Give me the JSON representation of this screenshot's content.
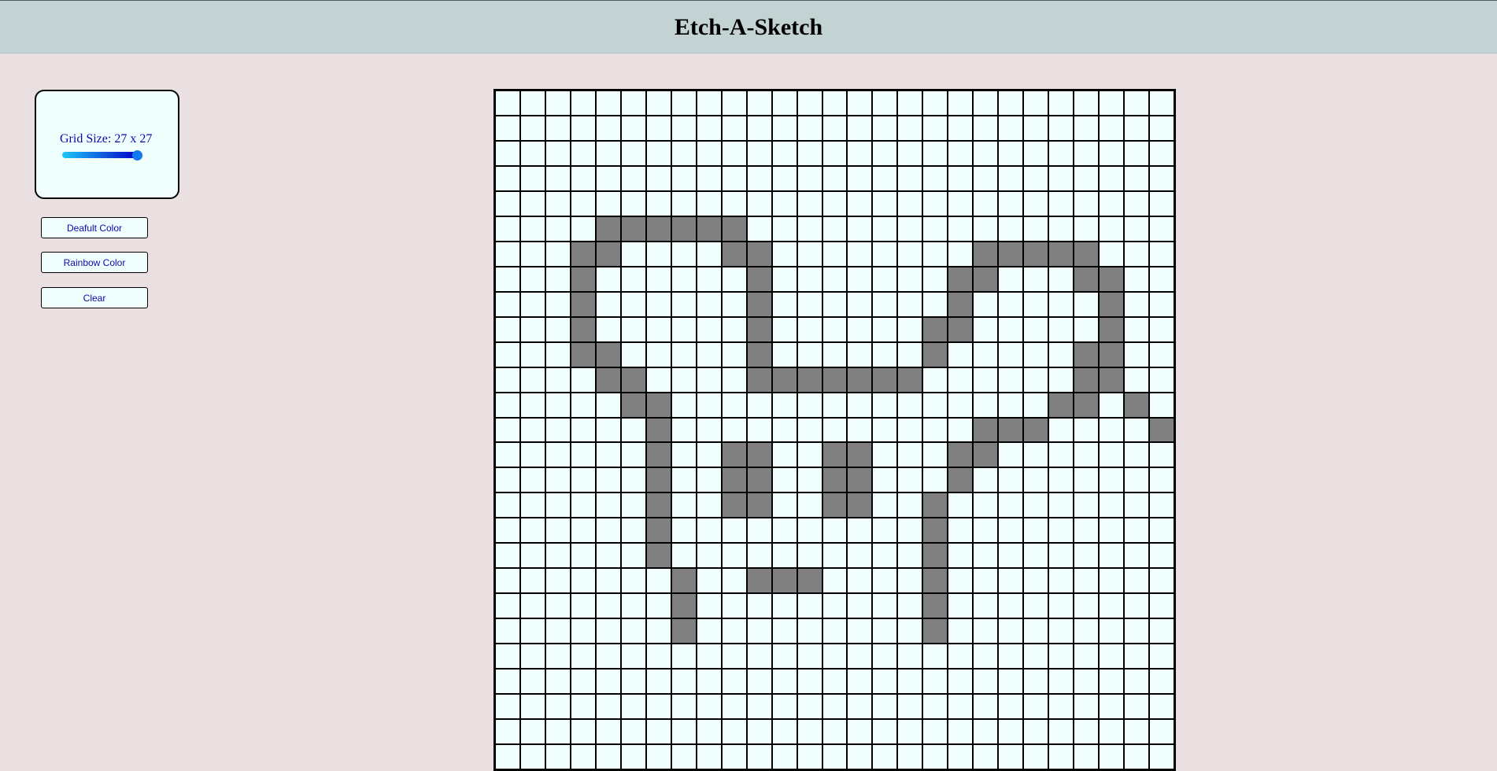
{
  "header": {
    "title": "Etch-A-Sketch"
  },
  "controls": {
    "grid_size_label": "Grid Size: 27 x 27",
    "slider": {
      "min": 1,
      "max": 27,
      "value": 27
    },
    "default_color_label": "Deafult Color",
    "rainbow_color_label": "Rainbow Color",
    "clear_label": "Clear"
  },
  "grid": {
    "size": 27,
    "colors": {
      "cell": "#f0fefe",
      "filled": "#808080",
      "border": "#000000"
    },
    "filled_cells": [
      [
        5,
        4
      ],
      [
        5,
        5
      ],
      [
        5,
        6
      ],
      [
        5,
        7
      ],
      [
        5,
        8
      ],
      [
        5,
        9
      ],
      [
        6,
        3
      ],
      [
        6,
        4
      ],
      [
        6,
        9
      ],
      [
        6,
        10
      ],
      [
        6,
        19
      ],
      [
        6,
        20
      ],
      [
        6,
        21
      ],
      [
        6,
        22
      ],
      [
        6,
        23
      ],
      [
        7,
        3
      ],
      [
        7,
        10
      ],
      [
        7,
        18
      ],
      [
        7,
        19
      ],
      [
        7,
        23
      ],
      [
        7,
        24
      ],
      [
        8,
        3
      ],
      [
        8,
        10
      ],
      [
        8,
        18
      ],
      [
        8,
        24
      ],
      [
        9,
        3
      ],
      [
        9,
        10
      ],
      [
        9,
        17
      ],
      [
        9,
        18
      ],
      [
        9,
        24
      ],
      [
        10,
        3
      ],
      [
        10,
        4
      ],
      [
        10,
        10
      ],
      [
        10,
        17
      ],
      [
        10,
        23
      ],
      [
        10,
        24
      ],
      [
        11,
        4
      ],
      [
        11,
        5
      ],
      [
        11,
        10
      ],
      [
        11,
        11
      ],
      [
        11,
        12
      ],
      [
        11,
        13
      ],
      [
        11,
        14
      ],
      [
        11,
        15
      ],
      [
        11,
        16
      ],
      [
        11,
        23
      ],
      [
        11,
        24
      ],
      [
        12,
        5
      ],
      [
        12,
        6
      ],
      [
        12,
        22
      ],
      [
        12,
        23
      ],
      [
        12,
        25
      ],
      [
        13,
        6
      ],
      [
        13,
        19
      ],
      [
        13,
        20
      ],
      [
        13,
        21
      ],
      [
        13,
        26
      ],
      [
        14,
        6
      ],
      [
        14,
        9
      ],
      [
        14,
        10
      ],
      [
        14,
        13
      ],
      [
        14,
        14
      ],
      [
        14,
        18
      ],
      [
        14,
        19
      ],
      [
        15,
        6
      ],
      [
        15,
        9
      ],
      [
        15,
        10
      ],
      [
        15,
        13
      ],
      [
        15,
        14
      ],
      [
        15,
        18
      ],
      [
        16,
        6
      ],
      [
        16,
        9
      ],
      [
        16,
        10
      ],
      [
        16,
        13
      ],
      [
        16,
        14
      ],
      [
        16,
        17
      ],
      [
        17,
        6
      ],
      [
        17,
        17
      ],
      [
        18,
        6
      ],
      [
        18,
        17
      ],
      [
        19,
        7
      ],
      [
        19,
        10
      ],
      [
        19,
        11
      ],
      [
        19,
        12
      ],
      [
        19,
        17
      ],
      [
        20,
        7
      ],
      [
        20,
        17
      ],
      [
        21,
        7
      ],
      [
        21,
        17
      ]
    ]
  }
}
